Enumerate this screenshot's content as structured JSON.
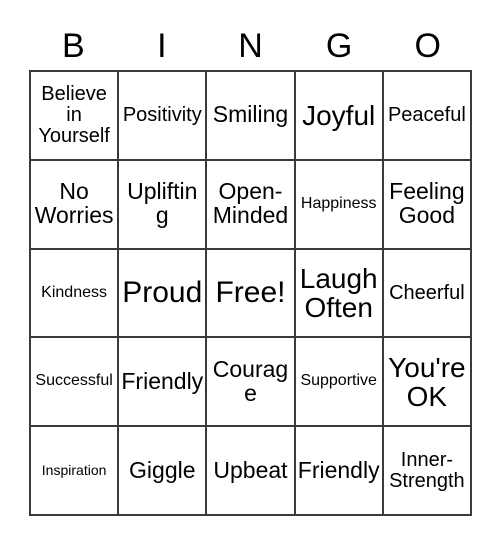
{
  "card": {
    "header_letters": [
      "B",
      "I",
      "N",
      "G",
      "O"
    ],
    "rows": [
      [
        {
          "text": "Believe in Yourself",
          "size": "sm"
        },
        {
          "text": "Positivity",
          "size": "sm"
        },
        {
          "text": "Smiling",
          "size": "md"
        },
        {
          "text": "Joyful",
          "size": "lg"
        },
        {
          "text": "Peaceful",
          "size": "sm"
        }
      ],
      [
        {
          "text": "No Worries",
          "size": "md"
        },
        {
          "text": "Uplifting",
          "size": "md"
        },
        {
          "text": "Open-Minded",
          "size": "md"
        },
        {
          "text": "Happiness",
          "size": "xs"
        },
        {
          "text": "Feeling Good",
          "size": "md"
        }
      ],
      [
        {
          "text": "Kindness",
          "size": "xs"
        },
        {
          "text": "Proud",
          "size": "xl"
        },
        {
          "text": "Free!",
          "size": "xl"
        },
        {
          "text": "Laugh Often",
          "size": "lg"
        },
        {
          "text": "Cheerful",
          "size": "sm"
        }
      ],
      [
        {
          "text": "Successful",
          "size": "xs"
        },
        {
          "text": "Friendly",
          "size": "md"
        },
        {
          "text": "Courage",
          "size": "md"
        },
        {
          "text": "Supportive",
          "size": "xs"
        },
        {
          "text": "You're OK",
          "size": "lg"
        }
      ],
      [
        {
          "text": "Inspiration",
          "size": "xxs"
        },
        {
          "text": "Giggle",
          "size": "md"
        },
        {
          "text": "Upbeat",
          "size": "md"
        },
        {
          "text": "Friendly",
          "size": "md"
        },
        {
          "text": "Inner-Strength",
          "size": "sm"
        }
      ]
    ],
    "colors": {
      "background": "#ffffff",
      "text": "#000000",
      "grid_line": "#3a3a3a"
    }
  }
}
